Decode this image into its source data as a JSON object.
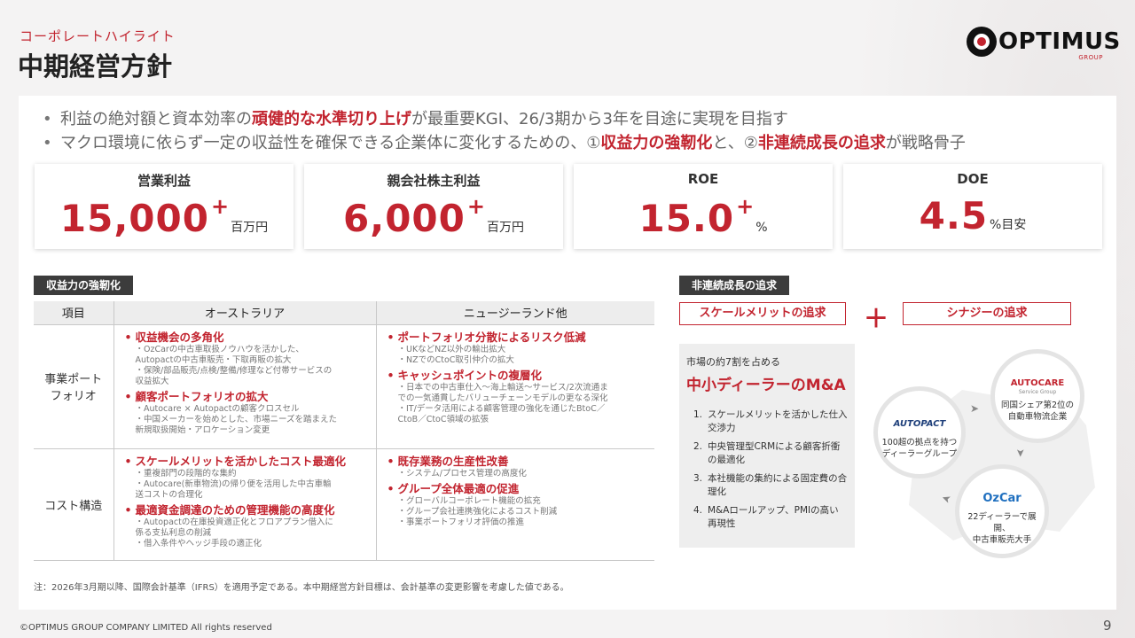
{
  "header": {
    "section_label": "コーポレートハイライト",
    "title": "中期経営方針",
    "logo_text": "OPTIMUS",
    "logo_sub": "GROUP"
  },
  "bullets": [
    {
      "pre": "利益の絶対額と資本効率の",
      "em": "頑健的な水準切り上げ",
      "post": "が最重要KGI、26/3期から3年を目途に実現を目指す"
    },
    {
      "pre": "マクロ環境に依らず一定の収益性を確保できる企業体に変化するための、①",
      "em": "収益力の強靭化",
      "mid": "と、②",
      "em2": "非連続成長の追求",
      "post": "が戦略骨子"
    }
  ],
  "kpis": [
    {
      "label": "営業利益",
      "value": "15,000",
      "plus": "+",
      "unit": "百万円"
    },
    {
      "label": "親会社株主利益",
      "value": "6,000",
      "plus": "+",
      "unit": "百万円"
    },
    {
      "label": "ROE",
      "value": "15.0",
      "plus": "+",
      "unit": "%"
    },
    {
      "label": "DOE",
      "value": "4.5",
      "plus": "",
      "unit": "%目安"
    }
  ],
  "strengthen": {
    "tag": "収益力の強靭化",
    "headers": [
      "項目",
      "オーストラリア",
      "ニュージーランド他"
    ],
    "rows": [
      {
        "label": "事業ポート\nフォリオ",
        "au": [
          {
            "head": "収益機会の多角化",
            "details": [
              "・OzCarの中古車取扱ノウハウを活かした、",
              "Autopactの中古車販売・下取再販の拡大",
              "・保険/部品販売/点検/整備/修理など付帯サービスの",
              "収益拡大"
            ]
          },
          {
            "head": "顧客ポートフォリオの拡大",
            "details": [
              "・Autocare × Autopactの顧客クロスセル",
              "・中国メーカーを始めとした、市場ニーズを踏まえた",
              "新規取扱開始・アロケーション変更"
            ]
          }
        ],
        "nz": [
          {
            "head": "ポートフォリオ分散によるリスク低減",
            "details": [
              "・UKなどNZ以外の輸出拡大",
              "・NZでのCtoC取引仲介の拡大"
            ]
          },
          {
            "head": "キャッシュポイントの複層化",
            "details": [
              "・日本での中古車仕入～海上輸送～サービス/2次流通ま",
              "での一気通貫したバリューチェーンモデルの更なる深化",
              "・IT/データ活用による顧客管理の強化を通じたBtoC／",
              "CtoB／CtoC領域の拡張"
            ]
          }
        ]
      },
      {
        "label": "コスト構造",
        "au": [
          {
            "head": "スケールメリットを活かしたコスト最適化",
            "details": [
              "・重複部門の段階的な集約",
              "・Autocare(新車物流)の帰り便を活用した中古車輸",
              "送コストの合理化"
            ]
          },
          {
            "head": "最適資金調達のための管理機能の高度化",
            "details": [
              "・Autopactの在庫投資適正化とフロアプラン借入に",
              "係る支払利息の削減",
              "・借入条件やヘッジ手段の適正化"
            ]
          }
        ],
        "nz": [
          {
            "head": "既存業務の生産性改善",
            "details": [
              "・システム/プロセス管理の高度化"
            ]
          },
          {
            "head": "グループ全体最適の促進",
            "details": [
              "・グローバルコーポレート機能の拡充",
              "・グループ会社連携強化によるコスト削減",
              "・事業ポートフォリオ評価の推進"
            ]
          }
        ]
      }
    ]
  },
  "growth": {
    "tag": "非連続成長の追求",
    "scale_tag": "スケールメリットの追求",
    "synergy_tag": "シナジーの追求",
    "plus": "＋",
    "intro": "市場の約7割を占める",
    "big": "中小ディーラーのM&A",
    "items": [
      {
        "n": "1.",
        "text": "スケールメリットを活かした仕入交渉力"
      },
      {
        "n": "2.",
        "text": "中央管理型CRMによる顧客折衝の最適化"
      },
      {
        "n": "3.",
        "text": "本社機能の集約による固定費の合理化"
      },
      {
        "n": "4.",
        "text": "M&Aロールアップ、PMIの高い再現性"
      }
    ],
    "circles": [
      {
        "brand": "AUTOPACT",
        "desc": "100超の拠点を持つ\nディーラーグループ"
      },
      {
        "brand": "AUTOCARE",
        "brand_sub": "Service Group",
        "desc": "同国シェア第2位の\n自動車物流企業"
      },
      {
        "brand": "OzCar",
        "desc": "22ディーラーで展開、\n中古車販売大手"
      }
    ]
  },
  "footer": {
    "note": "注：2026年3月期以降、国際会計基準（IFRS）を適用予定である。本中期経営方針目標は、会計基準の変更影響を考慮した値である。",
    "copyright": "©OPTIMUS GROUP COMPANY LIMITED All rights reserved",
    "page": "9"
  },
  "colors": {
    "accent": "#c2242f",
    "dark_tag": "#3c3c3c"
  }
}
